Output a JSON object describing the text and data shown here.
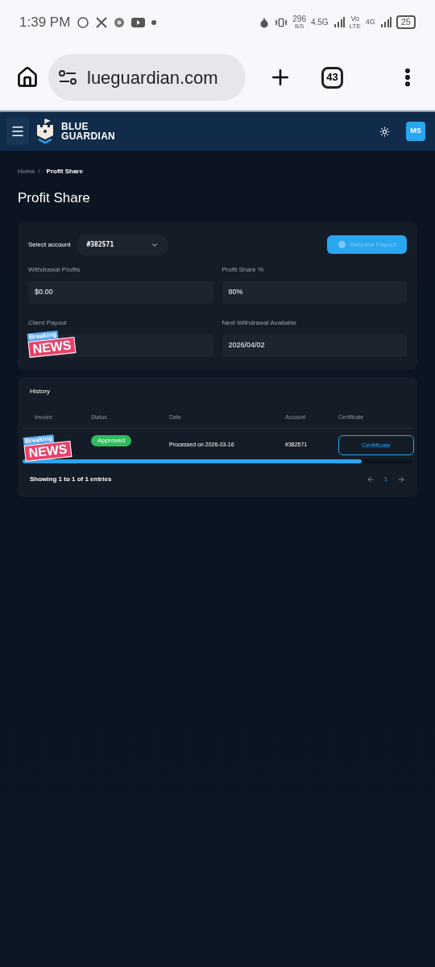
{
  "status_bar": {
    "time": "1:39 PM",
    "speed": "296",
    "speed_unit": "B/S",
    "net1": "4.5G",
    "volte_top": "Vo",
    "volte_bottom": "LTE",
    "net2": "4G",
    "battery": "25"
  },
  "browser": {
    "url": "lueguardian.com",
    "tab_count": "43"
  },
  "header": {
    "logo_line1": "BLUE",
    "logo_line2": "GUARDIAN",
    "avatar": "MS"
  },
  "breadcrumb": [
    {
      "label": "Home",
      "selected": false
    },
    {
      "label": "Profit Share",
      "selected": true
    }
  ],
  "breadcrumb_separator": "/",
  "title": "Profit Share",
  "account_select": {
    "label": "Select account",
    "value": "#382571"
  },
  "request_button": {
    "label": "Request Payout",
    "disabled": true
  },
  "fields": [
    {
      "label": "Withdrawal Profits",
      "value": "$0.00"
    },
    {
      "label": "Profit Share %",
      "value": "80%"
    },
    {
      "label": "Client Payout"
    },
    {
      "label": "Next Withdrawal Available",
      "value": "2026/04/02"
    }
  ],
  "history": {
    "title": "History",
    "columns": [
      "Invoice",
      "Status",
      "Date",
      "Account",
      "Certificate"
    ],
    "rows": [
      {
        "status": "Approved",
        "date": "Processed on 2026-03-16",
        "account": "#382571",
        "certificate": "Certificate"
      }
    ],
    "footer": "Showing 1 to 1 of 1 entries",
    "pages": [
      {
        "label": "1",
        "selected": true
      }
    ]
  },
  "stickers": [
    {
      "top": "Breaking",
      "bottom": "NEWS"
    },
    {
      "top": "Breaking",
      "bottom": "NEWS"
    }
  ]
}
